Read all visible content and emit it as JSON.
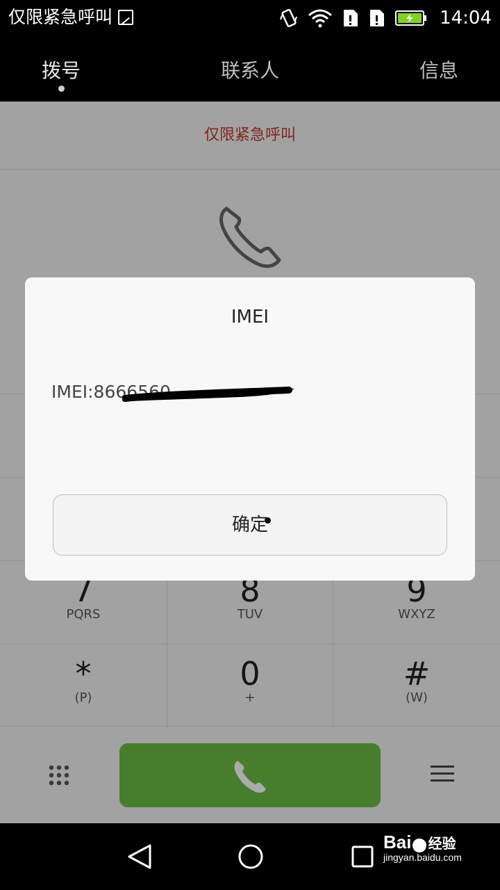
{
  "status_bar": {
    "carrier": "仅限紧急呼叫",
    "time": "14:04",
    "icons": [
      "gallery-icon",
      "vibrate-icon",
      "wifi-icon",
      "sim1-icon",
      "sim2-icon",
      "battery-charging-icon"
    ]
  },
  "tabs": [
    {
      "label": "拨号"
    },
    {
      "label": "联系人"
    },
    {
      "label": "信息"
    }
  ],
  "dialer": {
    "emergency_text": "仅限紧急呼叫",
    "keys": [
      {
        "num": "7",
        "letters": "PQRS"
      },
      {
        "num": "8",
        "letters": "TUV"
      },
      {
        "num": "9",
        "letters": "WXYZ"
      },
      {
        "num": "*",
        "letters": "(P)"
      },
      {
        "num": "0",
        "letters": "+"
      },
      {
        "num": "#",
        "letters": "(W)"
      }
    ],
    "call_color": "#6bbd45"
  },
  "dialog": {
    "title": "IMEI",
    "body": "IMEI:8666560",
    "ok_label": "确定"
  },
  "watermark": {
    "brand_a": "Bai",
    "brand_b": "经验",
    "url": "jingyan.baidu.com"
  }
}
